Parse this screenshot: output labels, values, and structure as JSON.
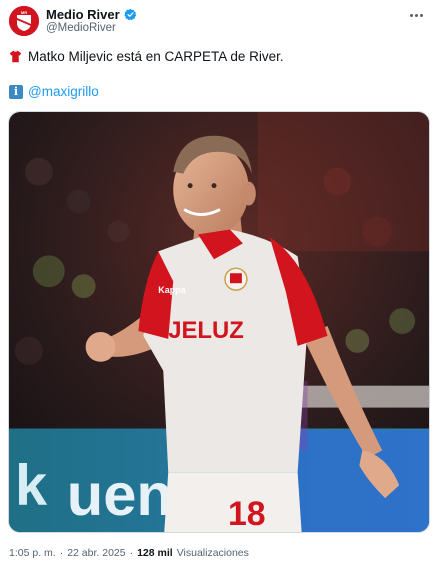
{
  "author": {
    "display_name": "Medio River",
    "handle": "@MedioRiver",
    "avatar_icon": "river-plate-crest-icon",
    "verified_icon": "verified-badge-icon"
  },
  "tweet": {
    "text": "Matko Miljevic está en CARPETA de River.",
    "leading_emoji": "red-jersey-emoji",
    "mention_emoji": "information-emoji",
    "mention": "@maxigrillo"
  },
  "media": {
    "jersey_sponsor": "JELUZ",
    "jersey_brand": "Kappa",
    "jersey_number": "18",
    "board_text": "uena",
    "board_left_text": "k"
  },
  "meta": {
    "time": "1:05 p. m.",
    "separator": "·",
    "date": "22 abr. 2025",
    "views_count": "128 mil",
    "views_label": "Visualizaciones"
  },
  "colors": {
    "brand_red": "#d2141e",
    "link_blue": "#1d9bf0",
    "secondary_text": "#536471"
  }
}
